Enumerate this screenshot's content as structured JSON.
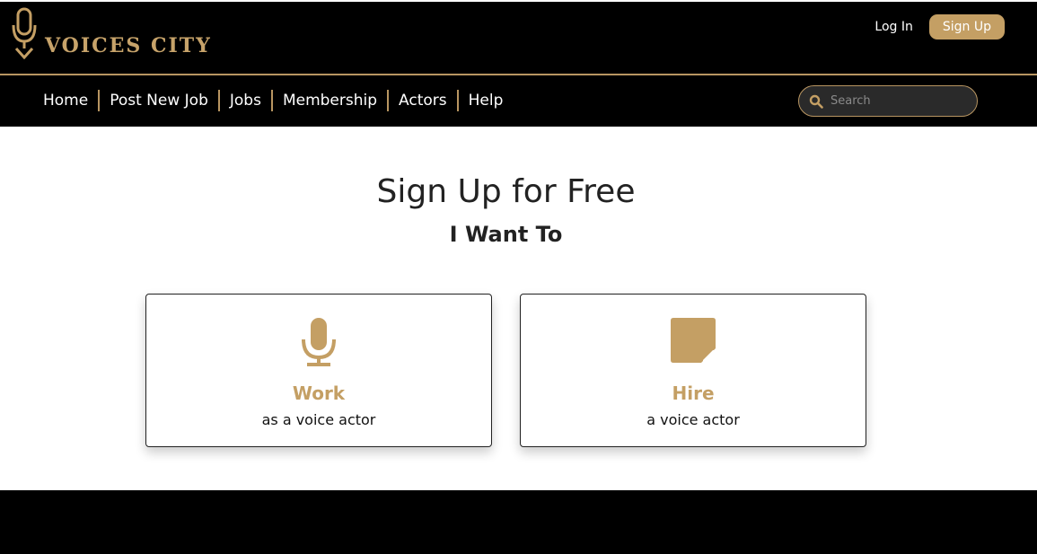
{
  "brand": {
    "name": "VOICES CITY",
    "accent_color": "#c49f64"
  },
  "header": {
    "login_label": "Log In",
    "signup_label": "Sign Up"
  },
  "nav": {
    "items": [
      "Home",
      "Post New Job",
      "Jobs",
      "Membership",
      "Actors",
      "Help"
    ],
    "search_placeholder": "Search",
    "search_icon": "search-icon"
  },
  "main": {
    "title": "Sign Up for Free",
    "subtitle": "I Want To",
    "cards": [
      {
        "icon": "microphone-icon",
        "title": "Work",
        "subtitle": "as a voice actor"
      },
      {
        "icon": "sticky-note-icon",
        "title": "Hire",
        "subtitle": "a voice actor"
      }
    ]
  }
}
